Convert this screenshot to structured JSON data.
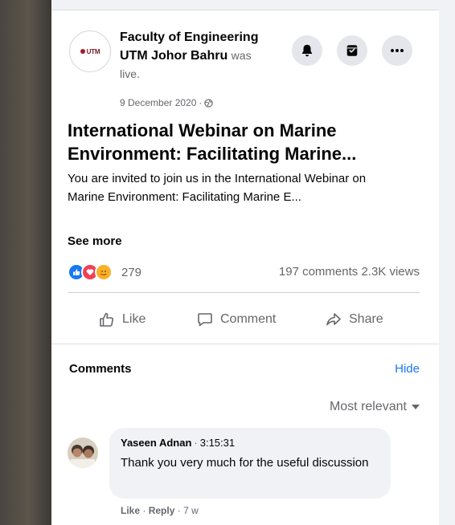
{
  "post": {
    "page_name": "Faculty of Engineering UTM Johor Bahru",
    "status_text": "was live.",
    "date": "9 December 2020",
    "date_sep": "·",
    "title": "International Webinar on Marine Environment: Facilitating Marine...",
    "description": "You are invited to join us in the International Webinar on Marine Environment: Facilitating Marine E...",
    "see_more": "See more",
    "avatar_logo_text": "UTM"
  },
  "header_buttons": [
    {
      "name": "notifications",
      "icon": "bell-icon"
    },
    {
      "name": "save",
      "icon": "bookmark-icon"
    },
    {
      "name": "more",
      "icon": "more-icon"
    }
  ],
  "stats": {
    "reactions_count": "279",
    "comments": "197 comments",
    "views": "2.3K views"
  },
  "actions": {
    "like": "Like",
    "comment": "Comment",
    "share": "Share"
  },
  "comments_section": {
    "heading": "Comments",
    "hide": "Hide",
    "sort": "Most relevant"
  },
  "comment": {
    "author": "Yaseen Adnan",
    "sep": "·",
    "time": "3:15:31",
    "text": "Thank you very much for the useful discussion",
    "like": "Like",
    "reply": "Reply",
    "age": "7 w"
  },
  "colors": {
    "link": "#1877f2",
    "secondary_text": "#65676b",
    "like_blue": "#1877f2",
    "love_red": "#f33e58",
    "haha_yellow": "#f7b125"
  }
}
